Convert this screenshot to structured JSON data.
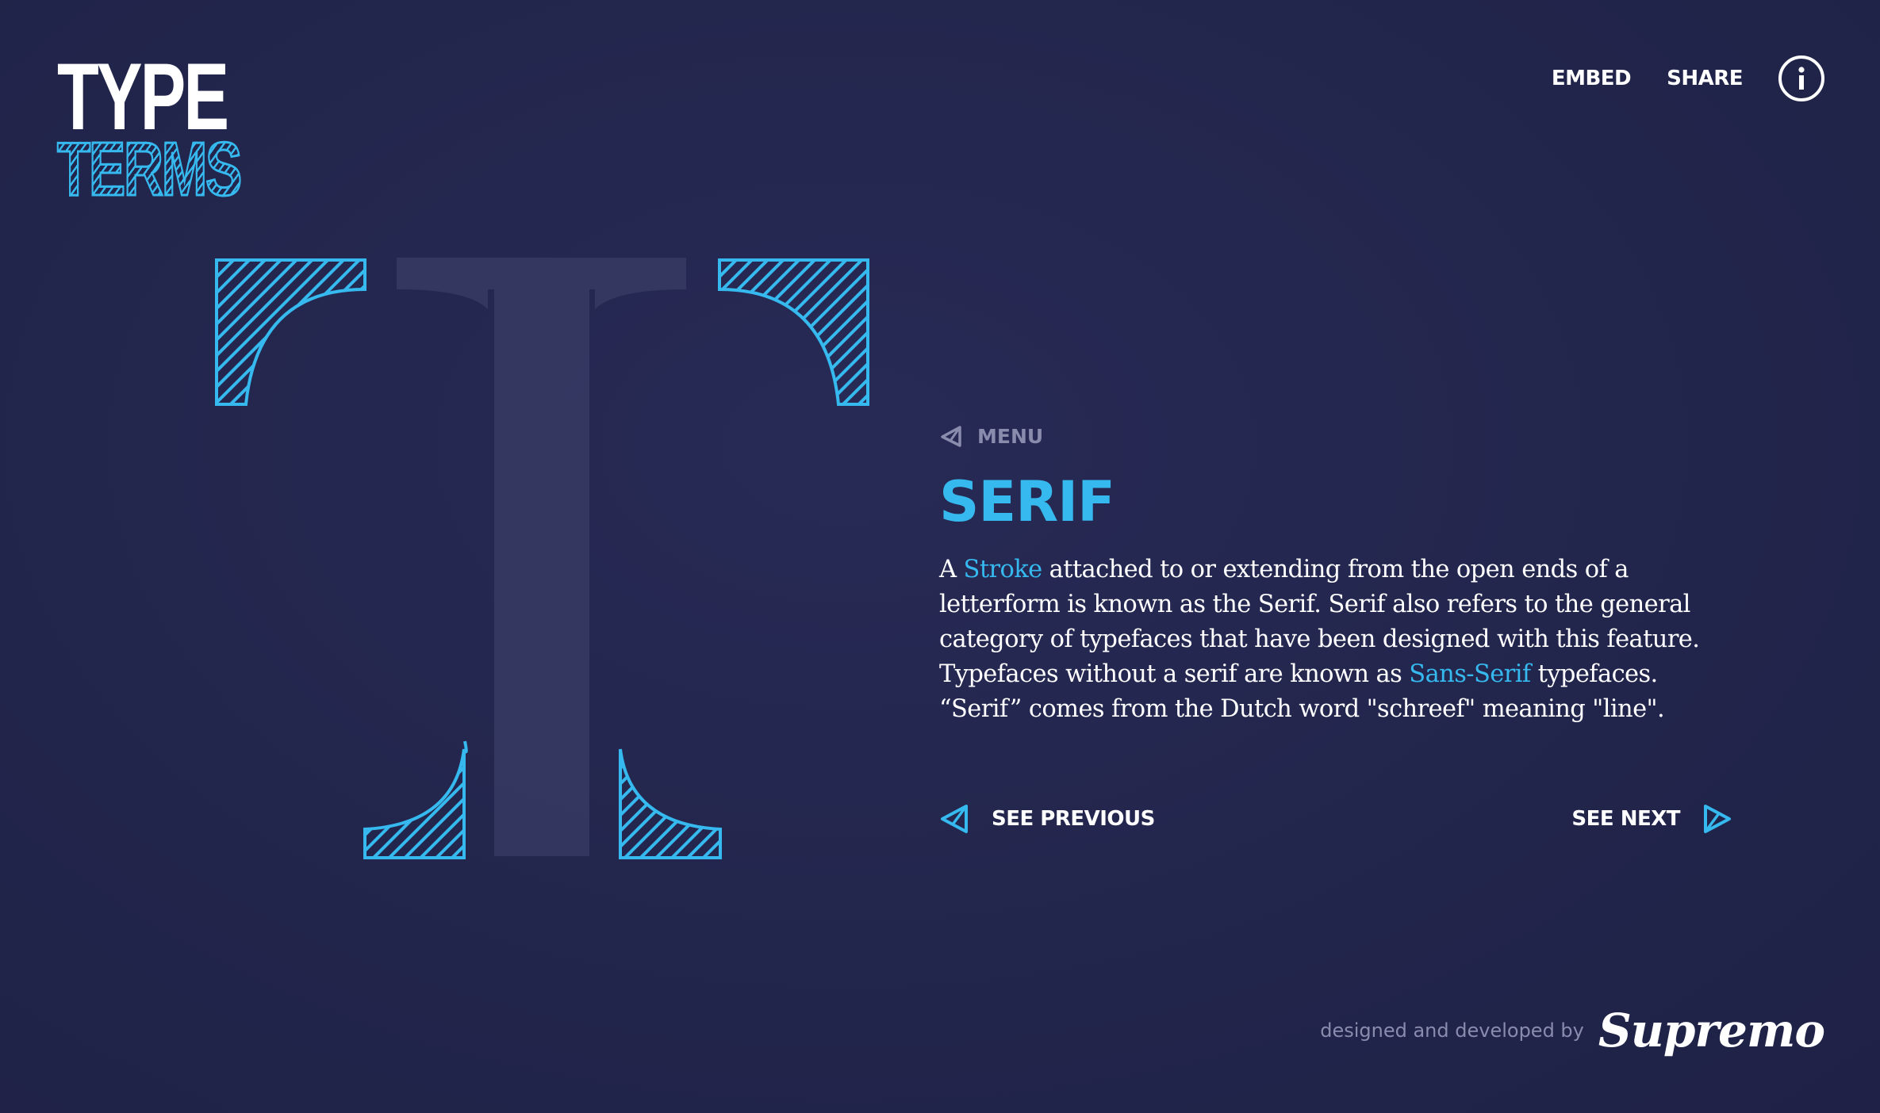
{
  "logo": {
    "line1": "TYPE",
    "line2": "TERMS"
  },
  "nav": {
    "embed": "EMBED",
    "share": "SHARE",
    "info_icon": "info-icon"
  },
  "menu": {
    "label": "MENU",
    "icon": "triangle-left-outline-icon"
  },
  "term": {
    "title": "SERIF",
    "desc_part1": "A ",
    "desc_link1": "Stroke",
    "desc_part2": " attached to or extending from the open ends of a letterform is known as the Serif. Serif also refers to the general category of typefaces that have been designed with this feature. Typefaces without a serif are known as ",
    "desc_link2": "Sans-Serif",
    "desc_part3": " typefaces. “Serif” comes from the Dutch word \"schreef\" meaning \"line\"."
  },
  "pager": {
    "previous": "SEE PREVIOUS",
    "next": "SEE NEXT"
  },
  "credit": {
    "text": "designed and developed by",
    "brand": "Supremo"
  },
  "illustration": {
    "letter": "T"
  },
  "colors": {
    "background": "#23264d",
    "accent": "#36b9ee",
    "muted": "#8a8cae",
    "text": "#ffffff"
  }
}
